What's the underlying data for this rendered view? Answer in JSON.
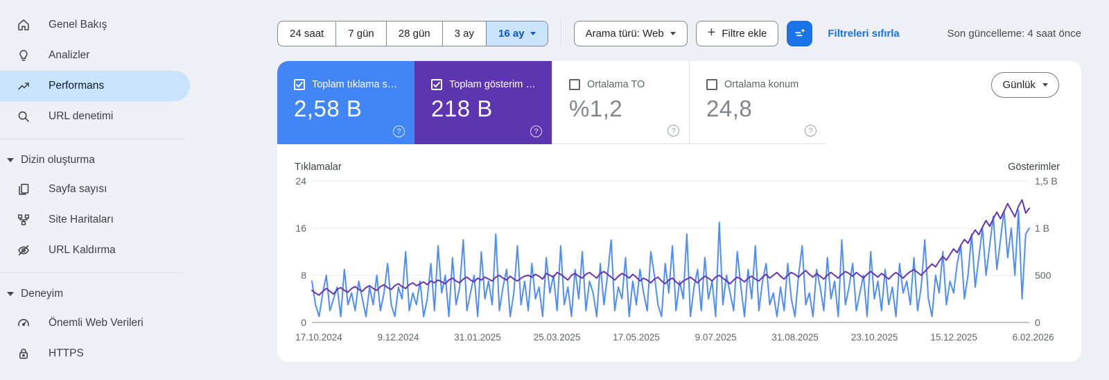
{
  "sidebar": {
    "items": [
      {
        "label": "Genel Bakış",
        "icon": "home"
      },
      {
        "label": "Analizler",
        "icon": "lightbulb"
      },
      {
        "label": "Performans",
        "icon": "performance",
        "selected": true
      },
      {
        "label": "URL denetimi",
        "icon": "search"
      }
    ],
    "sections": [
      {
        "label": "Dizin oluşturma",
        "items": [
          {
            "label": "Sayfa sayısı",
            "icon": "pages"
          },
          {
            "label": "Site Haritaları",
            "icon": "sitemap"
          },
          {
            "label": "URL Kaldırma",
            "icon": "eye-off"
          }
        ]
      },
      {
        "label": "Deneyim",
        "items": [
          {
            "label": "Önemli Web Verileri",
            "icon": "speedometer"
          },
          {
            "label": "HTTPS",
            "icon": "lock"
          }
        ]
      }
    ]
  },
  "toolbar": {
    "date_ranges": [
      "24 saat",
      "7 gün",
      "28 gün",
      "3 ay",
      "16 ay"
    ],
    "selected_range": "16 ay",
    "search_type_label": "Arama türü: Web",
    "add_filter_label": "Filtre ekle",
    "reset_filters_label": "Filtreleri sıfırla",
    "last_update_label": "Son güncelleme: 4 saat önce"
  },
  "cards": [
    {
      "label": "Toplam tıklama s…",
      "value": "2,58 B",
      "checked": true,
      "color": "#4285f4"
    },
    {
      "label": "Toplam gösterim …",
      "value": "218 B",
      "checked": true,
      "color": "#5e35b1"
    },
    {
      "label": "Ortalama TO",
      "value": "%1,2",
      "checked": false
    },
    {
      "label": "Ortalama konum",
      "value": "24,8",
      "checked": false
    }
  ],
  "granularity": {
    "label": "Günlük"
  },
  "chart_data": {
    "type": "line",
    "left_axis": {
      "label": "Tıklamalar",
      "ticks": [
        0,
        8,
        16,
        24
      ],
      "max": 24
    },
    "right_axis": {
      "label": "Gösterimler",
      "tick_labels": [
        "0",
        "500",
        "1 B",
        "1,5 B"
      ],
      "max": 1500
    },
    "x_tick_labels": [
      "17.10.2024",
      "9.12.2024",
      "31.01.2025",
      "25.03.2025",
      "17.05.2025",
      "9.07.2025",
      "31.08.2025",
      "23.10.2025",
      "15.12.2025",
      "6.02.2026"
    ],
    "grid": true,
    "series": [
      {
        "name": "Tıklamalar",
        "axis": "left",
        "color": "#4e8df6",
        "values": [
          7,
          3,
          1,
          5,
          8,
          2,
          4,
          6,
          1,
          9,
          3,
          5,
          2,
          7,
          4,
          1,
          6,
          3,
          8,
          2,
          5,
          10,
          3,
          1,
          6,
          4,
          12,
          2,
          5,
          3,
          7,
          1,
          4,
          10,
          2,
          13,
          5,
          8,
          1,
          11,
          3,
          6,
          14,
          2,
          5,
          8,
          1,
          12,
          4,
          7,
          3,
          15,
          2,
          6,
          9,
          1,
          5,
          13,
          3,
          7,
          2,
          10,
          4,
          6,
          1,
          11,
          5,
          8,
          2,
          13,
          3,
          6,
          1,
          9,
          4,
          12,
          2,
          7,
          5,
          1,
          10,
          3,
          8,
          14,
          2,
          6,
          4,
          11,
          1,
          7,
          3,
          9,
          5,
          2,
          12,
          8,
          3,
          1,
          10,
          5,
          13,
          2,
          7,
          4,
          15,
          1,
          6,
          9,
          2,
          11,
          4,
          7,
          1,
          17,
          3,
          8,
          5,
          2,
          12,
          6,
          1,
          9,
          4,
          13,
          2,
          7,
          10,
          3,
          5,
          1,
          6,
          2,
          10,
          4,
          1,
          8,
          13,
          3,
          5,
          1,
          9,
          6,
          2,
          11,
          4,
          7,
          1,
          14,
          3,
          6,
          10,
          2,
          5,
          8,
          1,
          12,
          4,
          7,
          2,
          9,
          3,
          6,
          1,
          10,
          5,
          7,
          3,
          11,
          2,
          6,
          14,
          4,
          1,
          8,
          5,
          12,
          3,
          7,
          5,
          10,
          13,
          4,
          8,
          15,
          6,
          11,
          16,
          8,
          13,
          18,
          9,
          14,
          19,
          11,
          16,
          8,
          19,
          4,
          15,
          16
        ]
      },
      {
        "name": "Gösterimler",
        "axis": "right",
        "color": "#6333b5",
        "values": [
          340,
          310,
          290,
          330,
          360,
          330,
          300,
          350,
          370,
          340,
          320,
          360,
          380,
          350,
          330,
          370,
          390,
          360,
          340,
          380,
          400,
          370,
          350,
          390,
          410,
          380,
          360,
          400,
          420,
          390,
          410,
          430,
          400,
          440,
          420,
          450,
          430,
          410,
          450,
          470,
          440,
          420,
          460,
          480,
          450,
          430,
          470,
          450,
          480,
          460,
          440,
          480,
          500,
          470,
          450,
          490,
          460,
          440,
          470,
          490,
          500,
          480,
          510,
          490,
          460,
          520,
          500,
          480,
          530,
          510,
          480,
          450,
          500,
          520,
          490,
          470,
          510,
          530,
          500,
          470,
          520,
          540,
          510,
          480,
          450,
          490,
          520,
          500,
          470,
          510,
          480,
          440,
          470,
          450,
          420,
          460,
          480,
          440,
          410,
          450,
          470,
          430,
          400,
          440,
          460,
          480,
          450,
          420,
          460,
          490,
          470,
          440,
          480,
          500,
          470,
          440,
          410,
          450,
          480,
          460,
          430,
          470,
          490,
          460,
          440,
          480,
          510,
          470,
          500,
          530,
          490,
          460,
          500,
          530,
          510,
          480,
          520,
          550,
          510,
          480,
          520,
          490,
          460,
          500,
          530,
          500,
          470,
          510,
          540,
          520,
          490,
          530,
          500,
          470,
          510,
          540,
          510,
          480,
          520,
          490,
          460,
          500,
          530,
          500,
          470,
          510,
          540,
          560,
          530,
          500,
          540,
          580,
          620,
          590,
          650,
          700,
          660,
          720,
          780,
          740,
          820,
          880,
          840,
          920,
          980,
          930,
          1010,
          1080,
          1020,
          1100,
          1170,
          1100,
          1180,
          1260,
          1190,
          1120,
          1230,
          1300,
          1160,
          1210
        ]
      }
    ],
    "colors": {
      "accent_blue": "#1a73e8",
      "card_blue": "#4285f4",
      "card_purple": "#5e35b1",
      "grid": "#e8eaed",
      "baseline": "#80868b"
    }
  }
}
